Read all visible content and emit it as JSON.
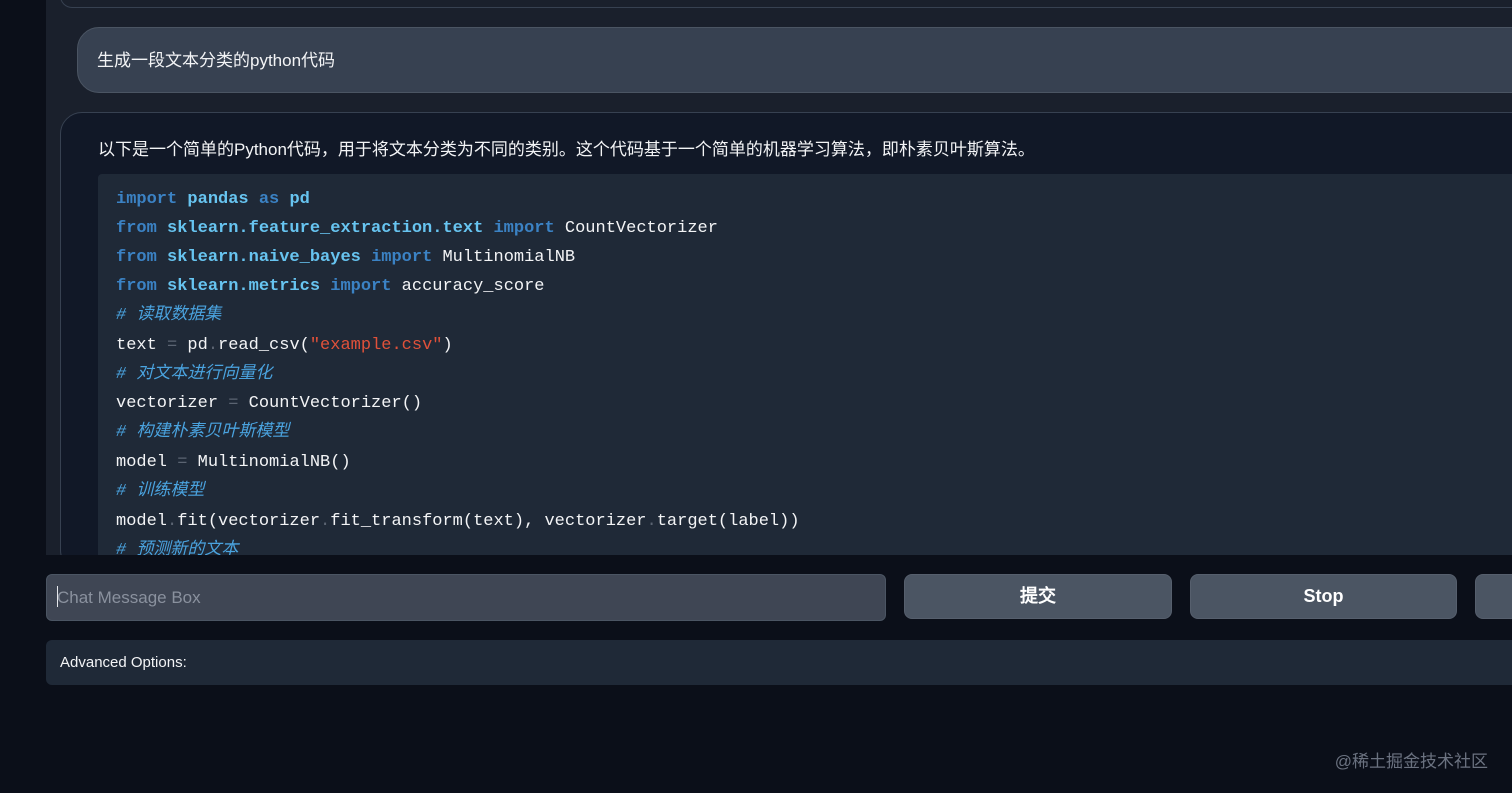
{
  "conversation": {
    "user_message": "生成一段文本分类的python代码",
    "bot_intro": "以下是一个简单的Python代码，用于将文本分类为不同的类别。这个代码基于一个简单的机器学习算法，即朴素贝叶斯算法。",
    "code_lines": [
      {
        "kw1": "import",
        "mod": "pandas",
        "kw2": "as",
        "rest": "pd"
      },
      {
        "kw1": "from",
        "mod": "sklearn.feature_extraction.text",
        "kw2": "import",
        "rest": "CountVectorizer"
      },
      {
        "kw1": "from",
        "mod": "sklearn.naive_bayes",
        "kw2": "import",
        "rest": "MultinomialNB"
      },
      {
        "kw1": "from",
        "mod": "sklearn.metrics",
        "kw2": "import",
        "rest": "accuracy_score"
      },
      {
        "comment": "# 读取数据集"
      },
      {
        "a": "text",
        "op": "=",
        "b": "pd",
        "dot": ".",
        "c": "read_csv(",
        "str": "\"example.csv\"",
        "d": ")"
      },
      {
        "comment": "# 对文本进行向量化"
      },
      {
        "a": "vectorizer",
        "op": "=",
        "b": "CountVectorizer()"
      },
      {
        "comment": "# 构建朴素贝叶斯模型"
      },
      {
        "a": "model",
        "op": "=",
        "b": "MultinomialNB()"
      },
      {
        "comment": "# 训练模型"
      },
      {
        "a": "model",
        "dot1": ".",
        "b": "fit(vectorizer",
        "dot2": ".",
        "c": "fit_transform(text), vectorizer",
        "dot3": ".",
        "d": "target(label))"
      },
      {
        "comment": "# 预测新的文本"
      }
    ]
  },
  "input": {
    "placeholder": "Chat Message Box"
  },
  "buttons": {
    "submit": "提交",
    "stop": "Stop"
  },
  "advanced_label": "Advanced Options:",
  "watermark": "@稀土掘金技术社区"
}
